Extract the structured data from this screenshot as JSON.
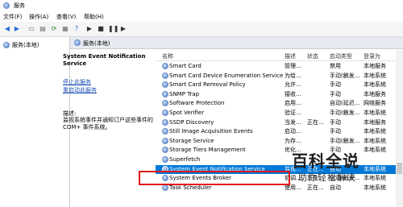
{
  "window": {
    "title": "服务"
  },
  "menu": [
    "文件(F)",
    "操作(A)",
    "查看(V)",
    "帮助(H)"
  ],
  "toolbar_icons": [
    "back-icon",
    "forward-icon",
    "console-icon",
    "properties-icon",
    "refresh-icon",
    "export-icon",
    "help-icon",
    "start-icon",
    "stop-icon",
    "pause-icon",
    "restart-icon"
  ],
  "tree": {
    "root_label": "服务(本地)"
  },
  "header": {
    "label": "服务(本地)"
  },
  "detail": {
    "service_name": "System Event Notification Service",
    "stop_link": "停止此服务",
    "restart_link": "重启动此服务",
    "desc_label": "描述:",
    "desc_text": "监视系统事件并通知订户这些事件的 COM+ 事件系统。"
  },
  "columns": {
    "name": "名称",
    "desc": "描述",
    "status": "状态",
    "startup": "启动类型",
    "logon": "登录为"
  },
  "rows": [
    {
      "name": "Smart Card",
      "desc": "管理...",
      "status": "",
      "startup": "禁用",
      "logon": "本地服务"
    },
    {
      "name": "Smart Card Device Enumeration Service",
      "desc": "为给...",
      "status": "",
      "startup": "手动(触发...",
      "logon": "本地系统"
    },
    {
      "name": "Smart Card Removal Policy",
      "desc": "允许...",
      "status": "",
      "startup": "手动",
      "logon": "本地系统"
    },
    {
      "name": "SNMP Trap",
      "desc": "接收...",
      "status": "",
      "startup": "手动",
      "logon": "本地服务"
    },
    {
      "name": "Software Protection",
      "desc": "启用...",
      "status": "",
      "startup": "自动(延迟...",
      "logon": "网络服务"
    },
    {
      "name": "Spot Verifier",
      "desc": "验证...",
      "status": "",
      "startup": "手动(触发...",
      "logon": "本地系统"
    },
    {
      "name": "SSDP Discovery",
      "desc": "当发...",
      "status": "正在...",
      "startup": "手动",
      "logon": "本地服务"
    },
    {
      "name": "Still Image Acquisition Events",
      "desc": "启动...",
      "status": "",
      "startup": "手动",
      "logon": "本地系统"
    },
    {
      "name": "Storage Service",
      "desc": "为存...",
      "status": "",
      "startup": "手动(触发...",
      "logon": "本地系统"
    },
    {
      "name": "Storage Tiers Management",
      "desc": "优化...",
      "status": "",
      "startup": "手动",
      "logon": "本地系统"
    },
    {
      "name": "Superfetch",
      "desc": "",
      "status": "",
      "startup": "",
      "logon": ""
    },
    {
      "name": "System Event Notification Service",
      "desc": "监视...",
      "status": "正在...",
      "startup": "自动",
      "logon": "本地系统"
    },
    {
      "name": "System Events Broker",
      "desc": "协调...",
      "status": "正在...",
      "startup": "自动(触发...",
      "logon": "本地系统"
    },
    {
      "name": "Task Scheduler",
      "desc": "使用...",
      "status": "正在...",
      "startup": "自动",
      "logon": "本地系统"
    }
  ],
  "selected_row": 11,
  "watermark": {
    "title": "百科全说",
    "subtitle": "助你轻松解决"
  },
  "colors": {
    "selection": "#0078d7",
    "highlight_box": "#e0161b",
    "link": "#1a4fb3"
  }
}
